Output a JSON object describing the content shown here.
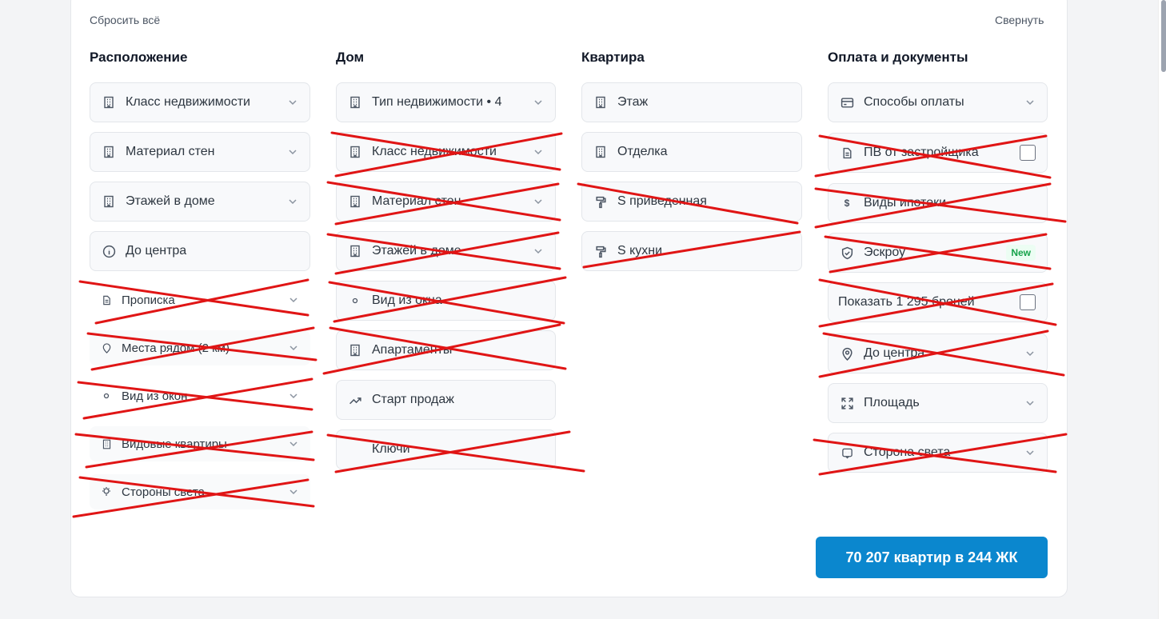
{
  "header": {
    "reset_label": "Сбросить всё",
    "collapse_label": "Свернуть"
  },
  "columns": {
    "location": {
      "title": "Расположение",
      "items": [
        "Класс недвижимости",
        "Материал стен",
        "Этажей в доме",
        "До центра",
        "Прописка",
        "Места рядом (2 км)",
        "Вид из окон",
        "Видовые квартиры",
        "Стороны света"
      ]
    },
    "house": {
      "title": "Дом",
      "items": [
        "Тип недвижимости • 4",
        "Класс недвижимости",
        "Материал стен",
        "Этажей в доме",
        "Вид из окна",
        "Апартаменты",
        "Старт продаж",
        "Ключи"
      ]
    },
    "apartment": {
      "title": "Квартира",
      "items": [
        "Этаж",
        "Отделка",
        "S приведенная",
        "S кухни"
      ]
    },
    "payment": {
      "title": "Оплата и документы",
      "items": [
        "Способы оплаты",
        "ПВ от застройщика",
        "Виды ипотеки",
        "Эскроу",
        "Показать 1 295 броней",
        "До центра",
        "Площадь",
        "Сторона света"
      ],
      "new_badge": "New"
    }
  },
  "cta": {
    "label": "70 207 квартир в 244 ЖК"
  },
  "colors": {
    "accent": "#0b87ce",
    "strike": "#e01515",
    "badge_green": "#16a34a"
  }
}
